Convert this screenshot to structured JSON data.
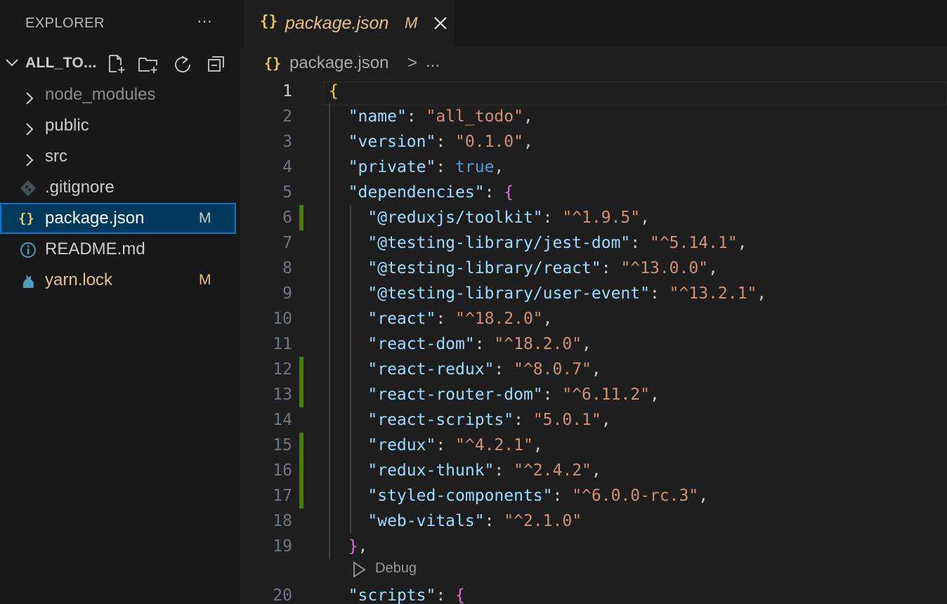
{
  "sidebar": {
    "title": "EXPLORER",
    "more_label": "···",
    "folder_name": "ALL_TO...",
    "items": [
      {
        "label": "node_modules",
        "kind": "folder",
        "style": "dim",
        "badge": ""
      },
      {
        "label": "public",
        "kind": "folder",
        "style": "normal",
        "badge": ""
      },
      {
        "label": "src",
        "kind": "folder",
        "style": "normal",
        "badge": ""
      },
      {
        "label": ".gitignore",
        "kind": "git",
        "style": "normal",
        "badge": ""
      },
      {
        "label": "package.json",
        "kind": "json",
        "style": "selected",
        "badge": "M"
      },
      {
        "label": "README.md",
        "kind": "info",
        "style": "normal",
        "badge": ""
      },
      {
        "label": "yarn.lock",
        "kind": "yarn",
        "style": "modified",
        "badge": "M"
      }
    ],
    "json_icon": "{}"
  },
  "tab": {
    "icon": "{}",
    "title": "package.json",
    "modified": "M"
  },
  "breadcrumb": {
    "icon": "{}",
    "file": "package.json",
    "separator": ">",
    "more": "..."
  },
  "codelens": "Debug",
  "colors": {
    "key": "#9cdcfe",
    "string": "#ce9178",
    "boolean": "#569cd6",
    "bracket_level1": "#ffd700",
    "bracket_level2": "#da70d6",
    "modified_gutter": "#487e02",
    "modified_text": "#e2c08d"
  },
  "code_lines": [
    {
      "n": "1",
      "active": true,
      "mod": false,
      "tokens": [
        [
          "b1",
          "{"
        ]
      ]
    },
    {
      "n": "2",
      "mod": false,
      "tokens": [
        [
          "p",
          "  "
        ],
        [
          "key",
          "\"name\""
        ],
        [
          "p",
          ": "
        ],
        [
          "str",
          "\"all_todo\""
        ],
        [
          "p",
          ","
        ]
      ]
    },
    {
      "n": "3",
      "mod": false,
      "tokens": [
        [
          "p",
          "  "
        ],
        [
          "key",
          "\"version\""
        ],
        [
          "p",
          ": "
        ],
        [
          "str",
          "\"0.1.0\""
        ],
        [
          "p",
          ","
        ]
      ]
    },
    {
      "n": "4",
      "mod": false,
      "tokens": [
        [
          "p",
          "  "
        ],
        [
          "key",
          "\"private\""
        ],
        [
          "p",
          ": "
        ],
        [
          "bool",
          "true"
        ],
        [
          "p",
          ","
        ]
      ]
    },
    {
      "n": "5",
      "mod": false,
      "tokens": [
        [
          "p",
          "  "
        ],
        [
          "key",
          "\"dependencies\""
        ],
        [
          "p",
          ": "
        ],
        [
          "b2",
          "{"
        ]
      ]
    },
    {
      "n": "6",
      "mod": true,
      "tokens": [
        [
          "p",
          "    "
        ],
        [
          "key",
          "\"@reduxjs/toolkit\""
        ],
        [
          "p",
          ": "
        ],
        [
          "str",
          "\"^1.9.5\""
        ],
        [
          "p",
          ","
        ]
      ]
    },
    {
      "n": "7",
      "mod": false,
      "tokens": [
        [
          "p",
          "    "
        ],
        [
          "key",
          "\"@testing-library/jest-dom\""
        ],
        [
          "p",
          ": "
        ],
        [
          "str",
          "\"^5.14.1\""
        ],
        [
          "p",
          ","
        ]
      ]
    },
    {
      "n": "8",
      "mod": false,
      "tokens": [
        [
          "p",
          "    "
        ],
        [
          "key",
          "\"@testing-library/react\""
        ],
        [
          "p",
          ": "
        ],
        [
          "str",
          "\"^13.0.0\""
        ],
        [
          "p",
          ","
        ]
      ]
    },
    {
      "n": "9",
      "mod": false,
      "tokens": [
        [
          "p",
          "    "
        ],
        [
          "key",
          "\"@testing-library/user-event\""
        ],
        [
          "p",
          ": "
        ],
        [
          "str",
          "\"^13.2.1\""
        ],
        [
          "p",
          ","
        ]
      ]
    },
    {
      "n": "10",
      "mod": false,
      "tokens": [
        [
          "p",
          "    "
        ],
        [
          "key",
          "\"react\""
        ],
        [
          "p",
          ": "
        ],
        [
          "str",
          "\"^18.2.0\""
        ],
        [
          "p",
          ","
        ]
      ]
    },
    {
      "n": "11",
      "mod": false,
      "tokens": [
        [
          "p",
          "    "
        ],
        [
          "key",
          "\"react-dom\""
        ],
        [
          "p",
          ": "
        ],
        [
          "str",
          "\"^18.2.0\""
        ],
        [
          "p",
          ","
        ]
      ]
    },
    {
      "n": "12",
      "mod": true,
      "tokens": [
        [
          "p",
          "    "
        ],
        [
          "key",
          "\"react-redux\""
        ],
        [
          "p",
          ": "
        ],
        [
          "str",
          "\"^8.0.7\""
        ],
        [
          "p",
          ","
        ]
      ]
    },
    {
      "n": "13",
      "mod": true,
      "tokens": [
        [
          "p",
          "    "
        ],
        [
          "key",
          "\"react-router-dom\""
        ],
        [
          "p",
          ": "
        ],
        [
          "str",
          "\"^6.11.2\""
        ],
        [
          "p",
          ","
        ]
      ]
    },
    {
      "n": "14",
      "mod": false,
      "tokens": [
        [
          "p",
          "    "
        ],
        [
          "key",
          "\"react-scripts\""
        ],
        [
          "p",
          ": "
        ],
        [
          "str",
          "\"5.0.1\""
        ],
        [
          "p",
          ","
        ]
      ]
    },
    {
      "n": "15",
      "mod": true,
      "tokens": [
        [
          "p",
          "    "
        ],
        [
          "key",
          "\"redux\""
        ],
        [
          "p",
          ": "
        ],
        [
          "str",
          "\"^4.2.1\""
        ],
        [
          "p",
          ","
        ]
      ]
    },
    {
      "n": "16",
      "mod": true,
      "tokens": [
        [
          "p",
          "    "
        ],
        [
          "key",
          "\"redux-thunk\""
        ],
        [
          "p",
          ": "
        ],
        [
          "str",
          "\"^2.4.2\""
        ],
        [
          "p",
          ","
        ]
      ]
    },
    {
      "n": "17",
      "mod": true,
      "tokens": [
        [
          "p",
          "    "
        ],
        [
          "key",
          "\"styled-components\""
        ],
        [
          "p",
          ": "
        ],
        [
          "str",
          "\"^6.0.0-rc.3\""
        ],
        [
          "p",
          ","
        ]
      ]
    },
    {
      "n": "18",
      "mod": false,
      "tokens": [
        [
          "p",
          "    "
        ],
        [
          "key",
          "\"web-vitals\""
        ],
        [
          "p",
          ": "
        ],
        [
          "str",
          "\"^2.1.0\""
        ]
      ]
    },
    {
      "n": "19",
      "mod": false,
      "tokens": [
        [
          "p",
          "  "
        ],
        [
          "b2",
          "}"
        ],
        [
          "p",
          ","
        ]
      ]
    },
    {
      "n": "20",
      "mod": false,
      "tokens": [
        [
          "p",
          "  "
        ],
        [
          "key",
          "\"scripts\""
        ],
        [
          "p",
          ": "
        ],
        [
          "b2",
          "{"
        ]
      ]
    }
  ]
}
